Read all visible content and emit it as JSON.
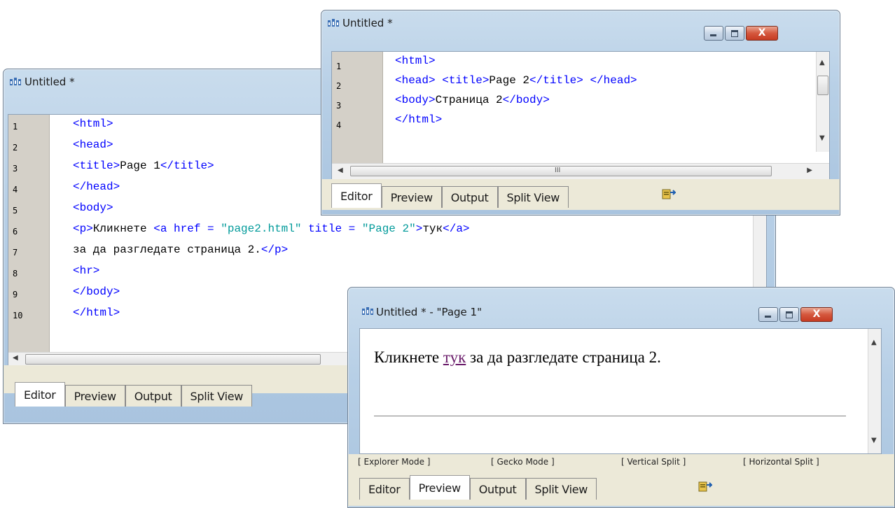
{
  "editor_window": {
    "title": "Untitled *",
    "line_numbers": [
      "1",
      "2",
      "3",
      "4",
      "5",
      "6",
      "7",
      "8",
      "9",
      "10"
    ],
    "code_lines": [
      [
        {
          "t": "tag",
          "v": "<html>"
        }
      ],
      [
        {
          "t": "tag",
          "v": "<head>"
        }
      ],
      [
        {
          "t": "tag",
          "v": "<title>"
        },
        {
          "t": "txt",
          "v": "Page 1"
        },
        {
          "t": "tag",
          "v": "</title>"
        }
      ],
      [
        {
          "t": "tag",
          "v": "</head>"
        }
      ],
      [
        {
          "t": "tag",
          "v": "<body>"
        }
      ],
      [
        {
          "t": "tag",
          "v": "<p>"
        },
        {
          "t": "txt",
          "v": "Кликнете "
        },
        {
          "t": "tag",
          "v": "<a href = "
        },
        {
          "t": "str",
          "v": "\"page2.html\""
        },
        {
          "t": "tag",
          "v": " title = "
        },
        {
          "t": "str",
          "v": "\"Page 2\""
        },
        {
          "t": "tag",
          "v": ">"
        },
        {
          "t": "txt",
          "v": "тук"
        },
        {
          "t": "tag",
          "v": "</a>"
        }
      ],
      [
        {
          "t": "txt",
          "v": "за да разгледате страница 2."
        },
        {
          "t": "tag",
          "v": "</p>"
        }
      ],
      [
        {
          "t": "tag",
          "v": "<hr>"
        }
      ],
      [
        {
          "t": "tag",
          "v": "</body>"
        }
      ],
      [
        {
          "t": "tag",
          "v": "</html>"
        }
      ]
    ],
    "tabs": [
      "Editor",
      "Preview",
      "Output",
      "Split View"
    ],
    "active_tab": "Editor"
  },
  "page2_window": {
    "title": "Untitled *",
    "line_numbers": [
      "1",
      "2",
      "3",
      "4"
    ],
    "code_lines": [
      [
        {
          "t": "tag",
          "v": "<html>"
        }
      ],
      [
        {
          "t": "tag",
          "v": "<head> <title>"
        },
        {
          "t": "txt",
          "v": "Page 2"
        },
        {
          "t": "tag",
          "v": "</title> </head>"
        }
      ],
      [
        {
          "t": "tag",
          "v": "<body>"
        },
        {
          "t": "txt",
          "v": "Страница 2"
        },
        {
          "t": "tag",
          "v": "</body>"
        }
      ],
      [
        {
          "t": "tag",
          "v": "</html>"
        }
      ]
    ],
    "scroll_marker": "III",
    "tabs": [
      "Editor",
      "Preview",
      "Output",
      "Split View"
    ],
    "active_tab": "Editor",
    "minimize_label": "",
    "close_label": "X"
  },
  "preview_window": {
    "title": "Untitled * - \"Page 1\"",
    "preview_before": "Кликнете ",
    "preview_link": "тук",
    "preview_after": " за да разгледате страница 2.",
    "modes": [
      "[ Explorer Mode ]",
      "[ Gecko Mode ]",
      "[ Vertical Split ]",
      "[ Horizontal Split ]"
    ],
    "tabs": [
      "Editor",
      "Preview",
      "Output",
      "Split View"
    ],
    "active_tab": "Preview",
    "close_label": "X"
  }
}
